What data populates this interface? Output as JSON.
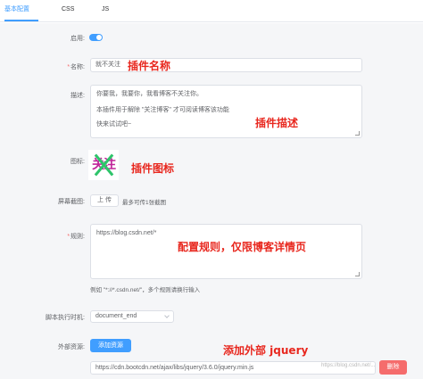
{
  "tabs": [
    "基本配置",
    "CSS",
    "JS"
  ],
  "form": {
    "enable_label": "启用:",
    "name_label": "名称:",
    "name_value": "就不关注",
    "desc_label": "描述:",
    "desc_lines": [
      "你要我，我要你，我看博客不关注你。",
      "",
      "本插件用于解除 \"关注博客\" 才可阅读博客该功能",
      "",
      "快来试试吧~"
    ],
    "icon_label": "图标:",
    "icon_text": "关注",
    "screenshot_label": "屏幕截图:",
    "upload_label": "上 传",
    "upload_hint": "最多可传1张截图",
    "rule_label": "规则:",
    "rule_value": "https://blog.csdn.net/*",
    "rule_hint": "例如 \"*://*.csdn.net/\"，多个规则请换行输入",
    "exec_label": "脚本执行时机:",
    "exec_value": "document_end",
    "external_label": "外部资源:",
    "add_resource_label": "添加资源",
    "resource_url": "https://cdn.bootcdn.net/ajax/libs/jquery/3.6.0/jquery.min.js",
    "delete_label": "删除"
  },
  "annotations": {
    "name": "插件名称",
    "desc": "插件描述",
    "icon": "插件图标",
    "rule": "配置规则，仅限博客详情页",
    "jquery": "添加外部 jquery"
  },
  "watermark": "https://blog.csdn.net/...",
  "colors": {
    "accent": "#409eff",
    "danger": "#f56c6c",
    "annotation": "#e8271e"
  }
}
